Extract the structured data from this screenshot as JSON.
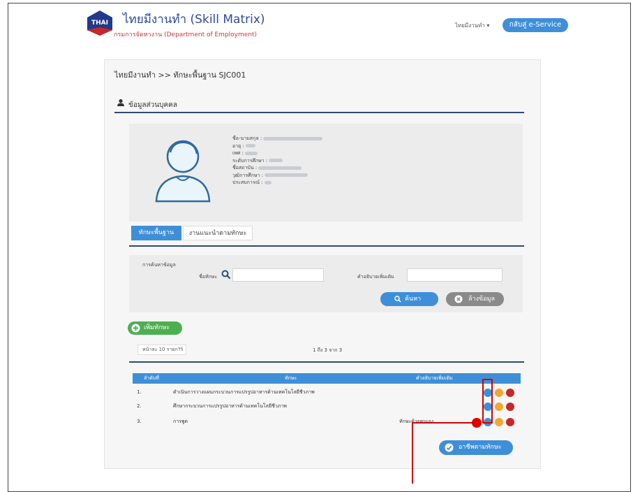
{
  "header": {
    "logo_text": "THAI",
    "title": "ไทยมีงานทำ (Skill Matrix)",
    "subtitle": "กรมการจัดหางาน (Department of Employment)",
    "user_menu": "ไทยมีงานทำ ▾",
    "back_button": "กลับสู่ e-Service"
  },
  "breadcrumb": "ไทยมีงานทำ >> ทักษะพื้นฐาน SJC001",
  "personal_section": {
    "title": "ข้อมูลส่วนบุคคล",
    "fields": [
      {
        "label": "ชื่อ-นามสกุล :"
      },
      {
        "label": "อายุ :"
      },
      {
        "label": "เพศ :"
      },
      {
        "label": "ระดับการศึกษา :"
      },
      {
        "label": "ชื่อสถาบัน :"
      },
      {
        "label": "วุฒิการศึกษา :"
      },
      {
        "label": "ประสบการณ์ :"
      }
    ]
  },
  "tabs": [
    "ทักษะพื้นฐาน",
    "งานแนะนำตามทักษะ"
  ],
  "search": {
    "heading": "การค้นหาข้อมูล",
    "skill_label": "ชื่อทักษะ",
    "desc_label": "คำอธิบายเพิ่มเติม",
    "search_button": "ค้นหา",
    "clear_button": "ล้างข้อมูล"
  },
  "add_button": "เพิ่มทักษะ",
  "pagination": {
    "page_size": "หน้าละ 10 รายการ",
    "info": "1 ถึง 3 จาก 3"
  },
  "table": {
    "columns": [
      "ลำดับที่",
      "ทักษะ",
      "คำอธิบายเพิ่มเติม"
    ],
    "rows": [
      {
        "no": "1.",
        "skill": "ดำเนินการวางแผนกระบวนการแปรรูปอาหารด้านเทคโนโลยีชีวภาพ",
        "desc": ""
      },
      {
        "no": "2.",
        "skill": "ศึกษากระบวนการแปรรูปอาหารด้านเทคโนโลยีชีวภาพ",
        "desc": ""
      },
      {
        "no": "3.",
        "skill": "การพูด",
        "desc": "ทักษะด้วยตนเอง"
      }
    ]
  },
  "career_button": "อาชีพตามทักษะ",
  "colors": {
    "primary": "#3f8fd8",
    "nav_dark": "#2d4a73",
    "add_green": "#4caf50",
    "highlight_red": "#d10000"
  }
}
